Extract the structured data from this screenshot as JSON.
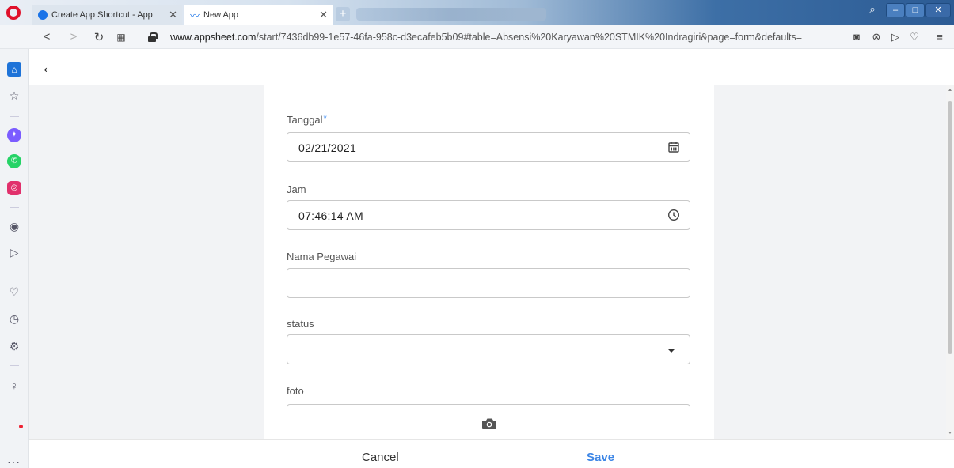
{
  "browser": {
    "tabs": [
      {
        "label": "Create App Shortcut - App",
        "close": "✕"
      },
      {
        "label": "New App",
        "close": "✕"
      }
    ],
    "newtab": "+",
    "url_domain": "www.appsheet.com",
    "url_path": "/start/7436db99-1e57-46fa-958c-d3ecafeb5b09#table=Absensi%20Karyawan%20STMIK%20Indragiri&page=form&defaults=",
    "controls": {
      "search": "⌕",
      "minimize": "–",
      "maximize": "□",
      "close": "✕"
    }
  },
  "app": {
    "back": "←"
  },
  "form": {
    "fields": [
      {
        "label": "Tanggal",
        "required": "*",
        "value": "02/21/2021",
        "icon": "calendar-icon"
      },
      {
        "label": "Jam",
        "value": "07:46:14 AM",
        "icon": "clock-icon"
      },
      {
        "label": "Nama Pegawai",
        "value": ""
      },
      {
        "label": "status",
        "value": "",
        "icon": "dropdown-caret"
      },
      {
        "label": "foto",
        "icon": "camera-icon"
      }
    ]
  },
  "footer": {
    "cancel": "Cancel",
    "save": "Save"
  },
  "colors": {
    "accent": "#3d86e6",
    "required": "#3f8ef5",
    "page_bg": "#f2f3f5"
  }
}
